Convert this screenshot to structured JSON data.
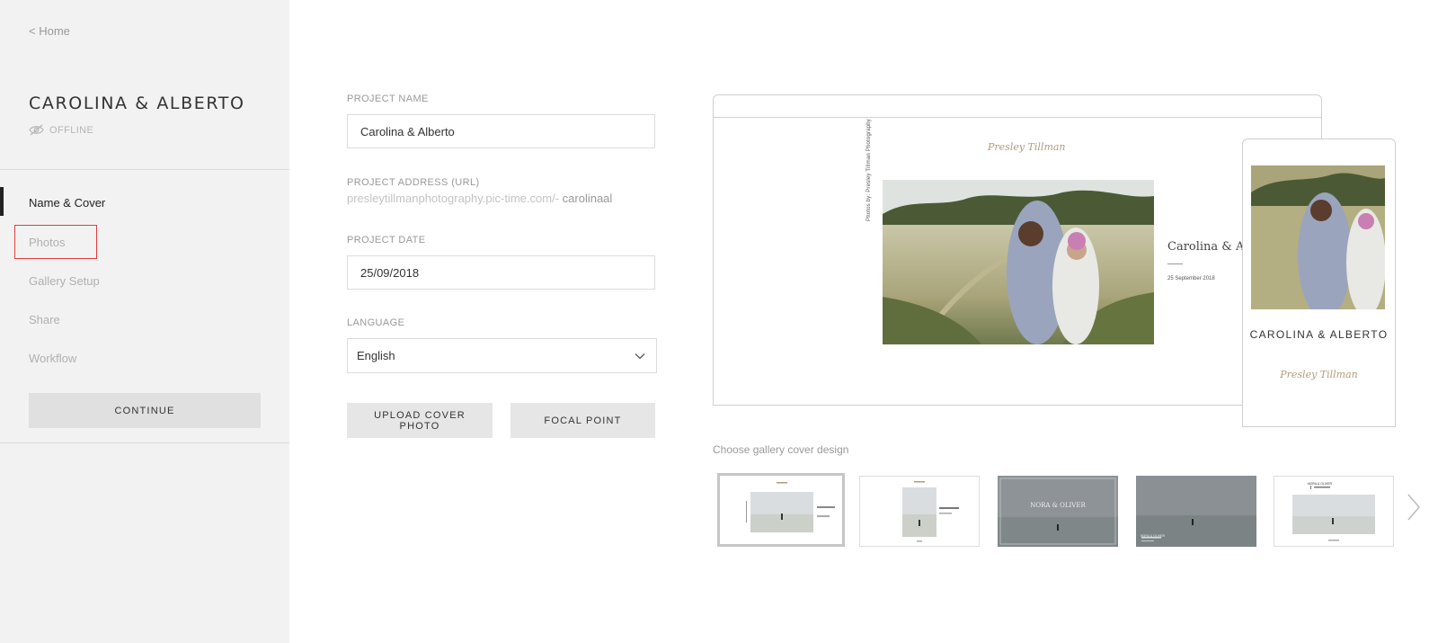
{
  "sidebar": {
    "home_link": "< Home",
    "project_title": "CAROLINA & ALBERTO",
    "status": "OFFLINE",
    "nav": [
      {
        "label": "Name & Cover"
      },
      {
        "label": "Photos"
      },
      {
        "label": "Gallery Setup"
      },
      {
        "label": "Share"
      },
      {
        "label": "Workflow"
      }
    ],
    "continue_label": "CONTINUE"
  },
  "form": {
    "name_label": "PROJECT NAME",
    "name_value": "Carolina & Alberto",
    "url_label": "PROJECT ADDRESS (URL)",
    "url_prefix": "presleytillmanphotography.pic-time.com/-",
    "url_slug": "carolinaal",
    "date_label": "PROJECT DATE",
    "date_value": "25/09/2018",
    "language_label": "LANGUAGE",
    "language_value": "English",
    "upload_label": "UPLOAD COVER PHOTO",
    "focal_label": "FOCAL POINT"
  },
  "preview": {
    "brand": "Presley Tillman",
    "credit": "Photos by: Presley Tillman Photography",
    "desktop_names": "Carolina & Albe",
    "desktop_date": "25 September 2018",
    "mobile_names": "CAROLINA & ALBERTO"
  },
  "designs": {
    "label": "Choose gallery cover design",
    "thumb_names": [
      "NORA & OLIVER",
      "NORA & OLIVER",
      "NORA & OLIVER"
    ]
  },
  "colors": {
    "accent": "#222222",
    "highlight": "#e23b3b",
    "brand_script": "#b39a7a"
  }
}
